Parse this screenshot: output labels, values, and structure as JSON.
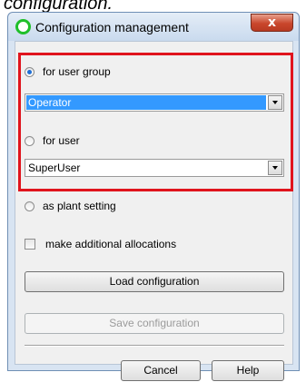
{
  "caption": "configuration.",
  "window": {
    "title": "Configuration management",
    "close_label": "x"
  },
  "options": {
    "user_group_label": "for user group",
    "user_group_value": "Operator",
    "user_label": "for user",
    "user_value": "SuperUser",
    "plant_label": "as plant setting",
    "additional_label": "make additional allocations"
  },
  "buttons": {
    "load": "Load configuration",
    "save": "Save configuration",
    "cancel": "Cancel",
    "help": "Help"
  },
  "colors": {
    "highlight": "#e0141d",
    "selection": "#3399ff",
    "title_icon": "#1fbf2a"
  }
}
